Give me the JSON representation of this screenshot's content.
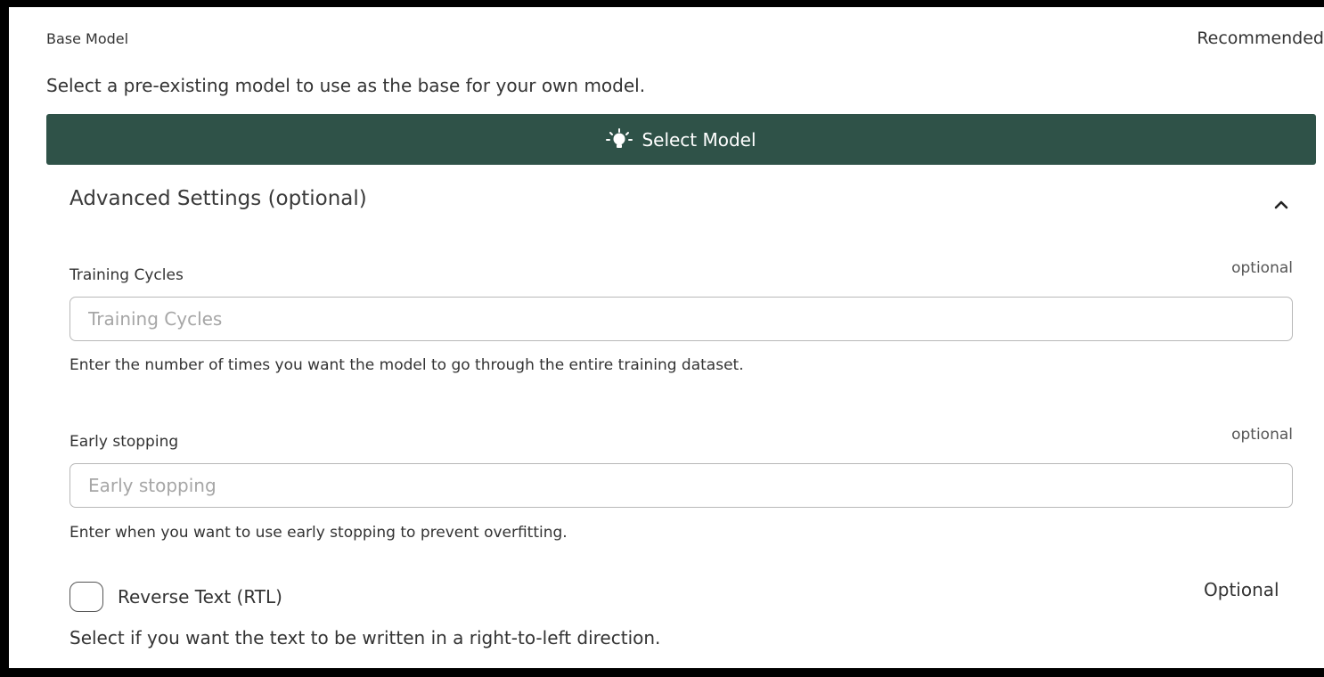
{
  "base_model": {
    "label": "Base Model",
    "badge": "Recommended",
    "description": "Select a pre-existing model to use as the base for your own model.",
    "select_button_label": "Select Model",
    "select_button_icon": "lightbulb-icon",
    "button_color": "#2f5248"
  },
  "advanced": {
    "title": "Advanced Settings (optional)",
    "toggle_icon": "chevron-up-icon",
    "fields": {
      "training_cycles": {
        "label": "Training Cycles",
        "optional": "optional",
        "value": "",
        "placeholder": "Training Cycles",
        "help": "Enter the number of times you want the model to go through the entire training dataset."
      },
      "early_stopping": {
        "label": "Early stopping",
        "optional": "optional",
        "value": "",
        "placeholder": "Early stopping",
        "help": "Enter when you want to use early stopping to prevent overfitting."
      }
    },
    "reverse_text": {
      "label": "Reverse Text (RTL)",
      "optional": "Optional",
      "checked": false,
      "description": "Select if you want the text to be written in a right-to-left direction."
    }
  }
}
